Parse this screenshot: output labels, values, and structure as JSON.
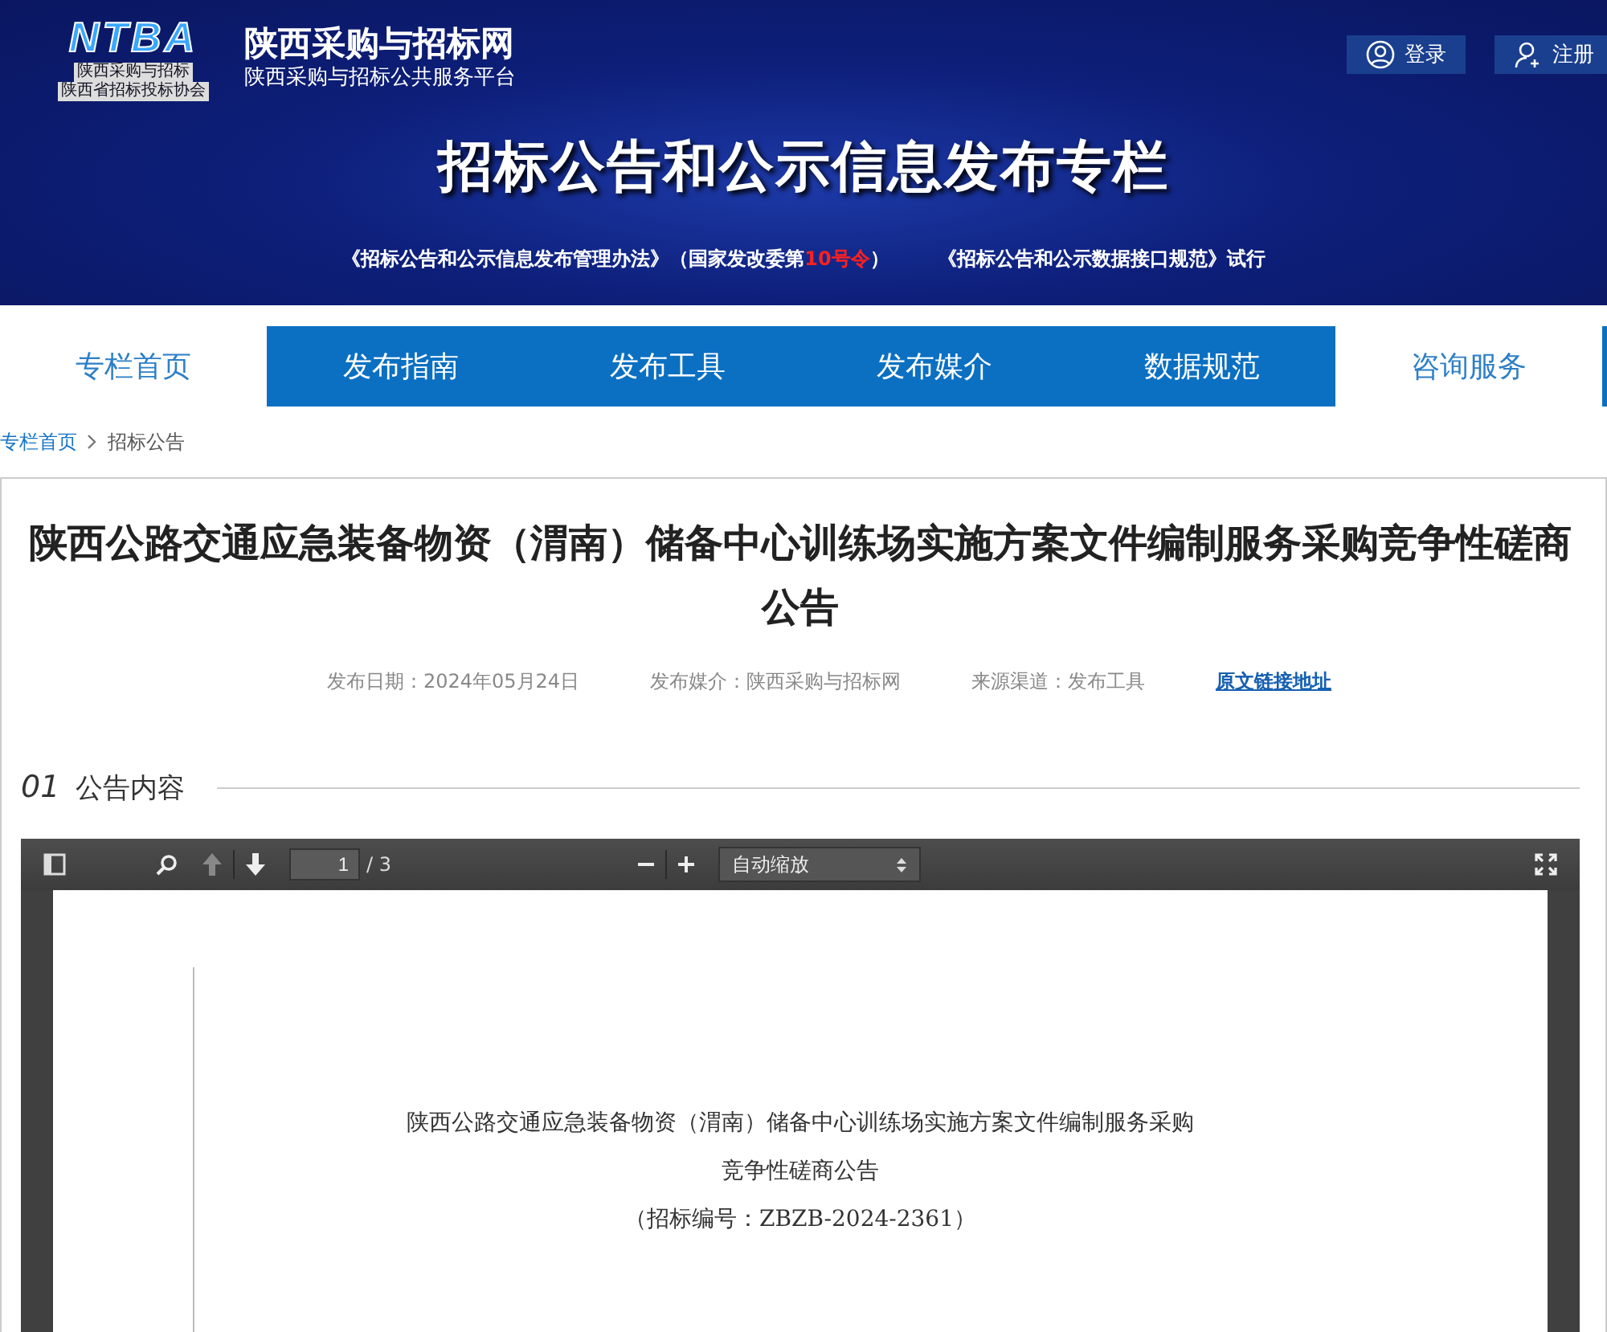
{
  "header": {
    "logo": {
      "mark": "NTBA",
      "line_1": "陕西采购与招标",
      "line_2": "陕西省招标投标协会"
    },
    "site_name": "陕西采购与招标网",
    "site_subtitle": "陕西采购与招标公共服务平台",
    "buttons": [
      {
        "kind": "login",
        "label": "登录"
      },
      {
        "kind": "register",
        "label": "注册"
      }
    ],
    "banner_title": "招标公告和公示信息发布专栏",
    "notices": [
      {
        "text": "《招标公告和公示信息发布管理办法》（国家发改委第",
        "highlight": "10号令",
        "tail": "）"
      },
      {
        "text": "《招标公告和公示数据接口规范》试行"
      }
    ]
  },
  "nav": [
    {
      "label": "专栏首页",
      "selected": true,
      "hovered": false
    },
    {
      "label": "发布指南",
      "selected": false,
      "hovered": false
    },
    {
      "label": "发布工具",
      "selected": false,
      "hovered": false
    },
    {
      "label": "发布媒介",
      "selected": false,
      "hovered": false
    },
    {
      "label": "数据规范",
      "selected": false,
      "hovered": false
    },
    {
      "label": "咨询服务",
      "selected": false,
      "hovered": true
    }
  ],
  "breadcrumb": {
    "home": "专栏首页",
    "current": "招标公告"
  },
  "article": {
    "title": "陕西公路交通应急装备物资（渭南）储备中心训练场实施方案文件编制服务采购竞争性磋商公告",
    "meta": [
      "发布日期：2024年05月24日",
      "发布媒介：陕西采购与招标网",
      "来源渠道：发布工具"
    ],
    "source_link": "原文链接地址",
    "section": {
      "number": "01",
      "title": "公告内容"
    }
  },
  "pdf_viewer": {
    "page_number": "1",
    "page_count": "/ 3",
    "zoom": "自动缩放",
    "document_lines": [
      "陕西公路交通应急装备物资（渭南）储备中心训练场实施方案文件编制服务采购",
      "竞争性磋商公告",
      "（招标编号：ZBZB-2024-2361）"
    ]
  }
}
